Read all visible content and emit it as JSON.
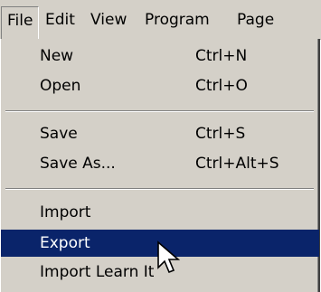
{
  "menubar": {
    "items": [
      "File",
      "Edit",
      "View",
      "Program",
      "Page"
    ]
  },
  "file_menu": {
    "items": [
      {
        "label": "New",
        "shortcut": "Ctrl+N"
      },
      {
        "label": "Open",
        "shortcut": "Ctrl+O"
      },
      {
        "label": "Save",
        "shortcut": "Ctrl+S"
      },
      {
        "label": "Save As...",
        "shortcut": "Ctrl+Alt+S"
      },
      {
        "label": "Import",
        "shortcut": ""
      },
      {
        "label": "Export",
        "shortcut": ""
      },
      {
        "label": "Import Learn It",
        "shortcut": ""
      }
    ],
    "highlighted": "Export"
  },
  "colors": {
    "menu_bg": "#d4d0c8",
    "highlight_bg": "#0a246a",
    "highlight_text": "#ffffff"
  },
  "cursor_icon": "arrow-cursor-icon"
}
